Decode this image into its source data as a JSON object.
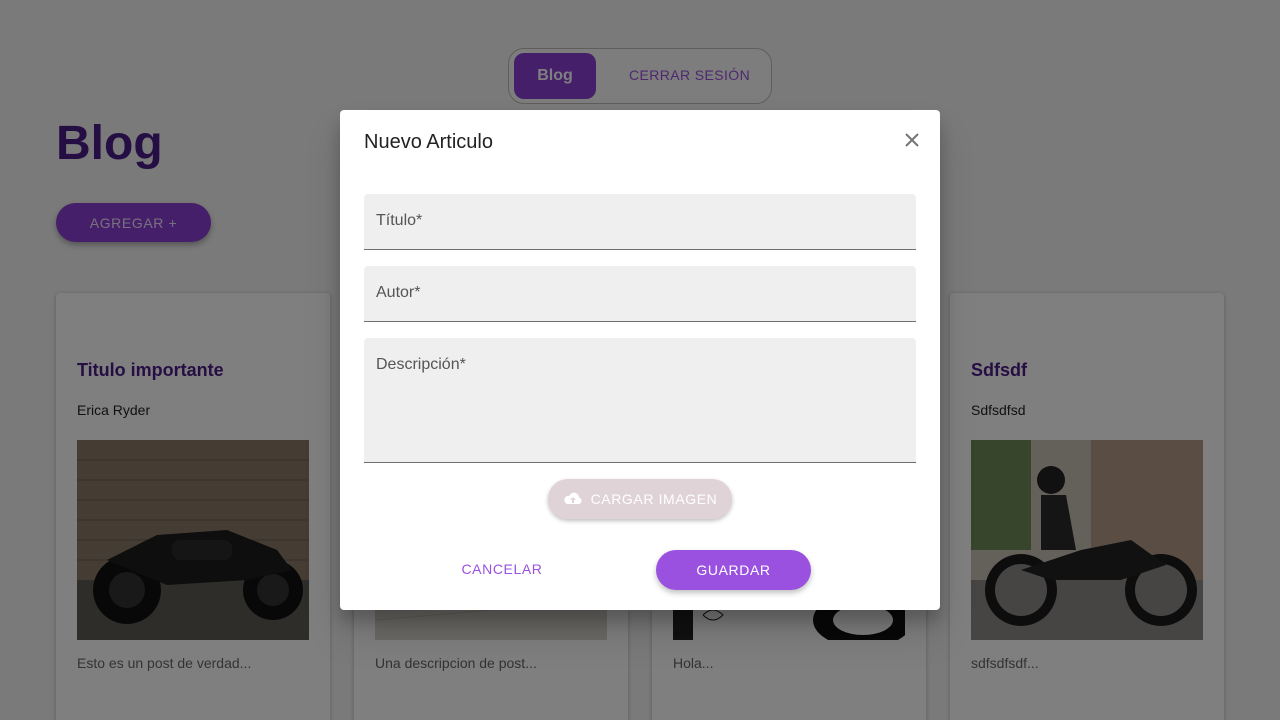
{
  "nav": {
    "blog_label": "Blog",
    "logout_label": "CERRAR SESIÓN"
  },
  "page": {
    "title": "Blog",
    "add_label": "AGREGAR +"
  },
  "cards": [
    {
      "title": "Titulo importante",
      "author": "Erica Ryder",
      "description": "Esto es un post de verdad..."
    },
    {
      "title": "",
      "author": "",
      "description": "Una descripcion de post..."
    },
    {
      "title": "",
      "author": "",
      "description": "Hola..."
    },
    {
      "title": "Sdfsdf",
      "author": "Sdfsdfsd",
      "description": "sdfsdfsdf..."
    }
  ],
  "dialog": {
    "title": "Nuevo Articulo",
    "fields": {
      "titulo": {
        "label": "Título",
        "required": "*",
        "value": ""
      },
      "autor": {
        "label": "Autor",
        "required": "*",
        "value": ""
      },
      "descripcion": {
        "label": "Descripción",
        "required": "*",
        "value": ""
      }
    },
    "upload_label": "CARGAR IMAGEN",
    "cancel_label": "CANCELAR",
    "save_label": "GUARDAR"
  },
  "colors": {
    "accent": "#9b51e0",
    "accent_dark": "#8d3fd6",
    "title_purple": "#4b1c86",
    "upload_bg": "#e0d3d8"
  },
  "icons": {
    "close": "close-icon",
    "upload": "cloud-upload-icon"
  }
}
